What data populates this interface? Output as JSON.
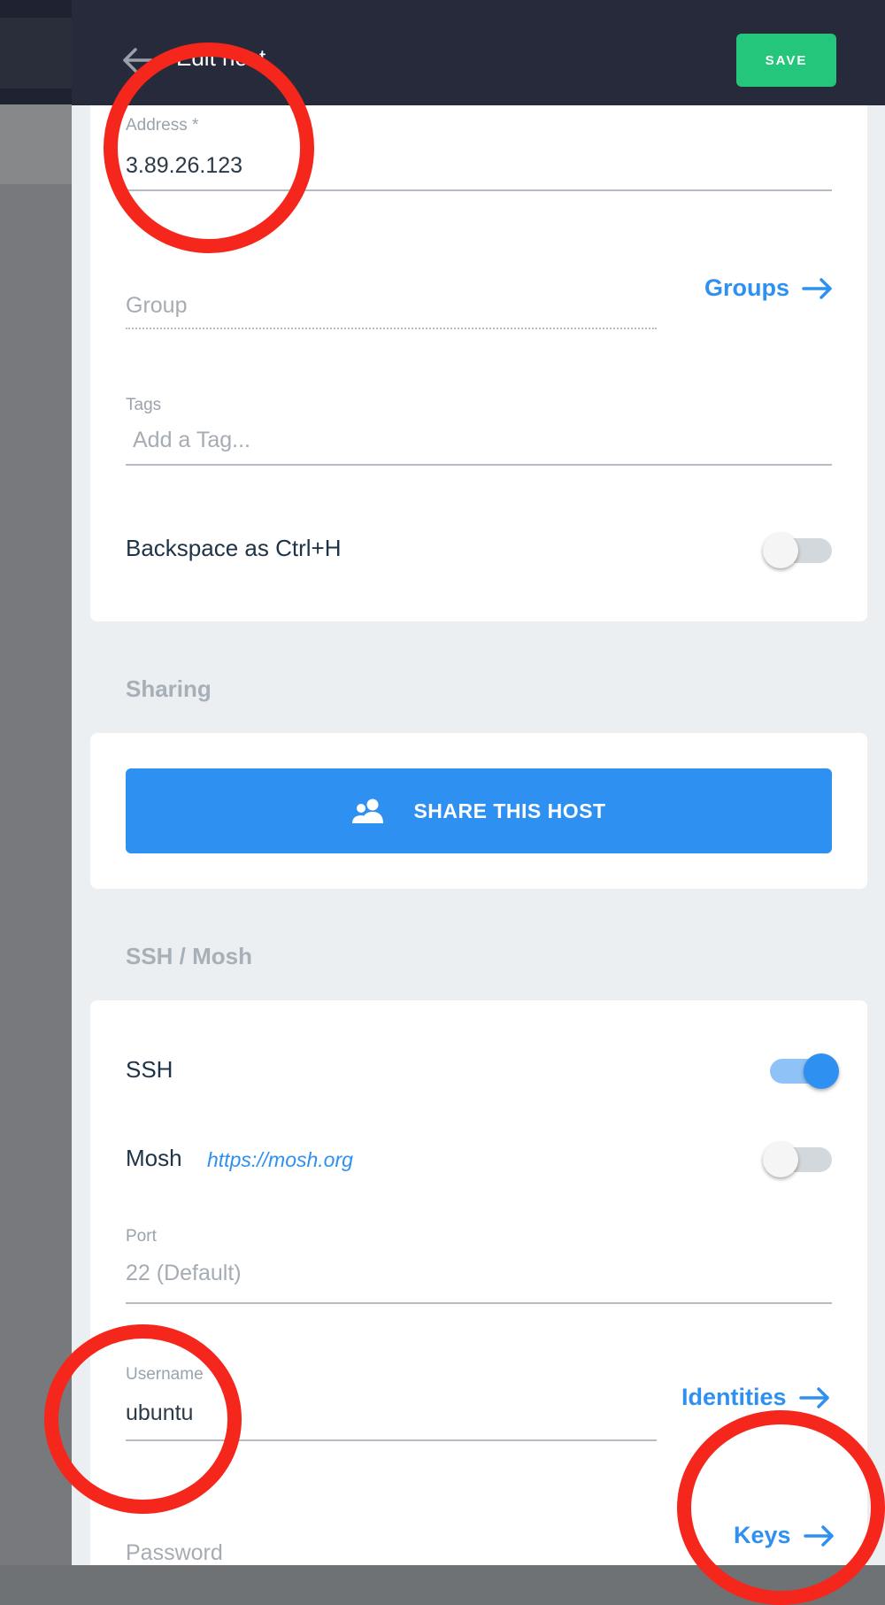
{
  "header": {
    "title": "Edit host",
    "save_label": "SAVE"
  },
  "general": {
    "address_label": "Address *",
    "address_value": "3.89.26.123",
    "group_placeholder": "Group",
    "groups_link": "Groups",
    "tags_label": "Tags",
    "tags_placeholder": "Add a Tag...",
    "backspace_label": "Backspace as Ctrl+H",
    "backspace_enabled": false
  },
  "sharing": {
    "section_title": "Sharing",
    "share_button": "SHARE THIS HOST"
  },
  "ssh_mosh": {
    "section_title": "SSH / Mosh",
    "ssh_label": "SSH",
    "ssh_enabled": true,
    "mosh_label": "Mosh",
    "mosh_link": "https://mosh.org",
    "mosh_enabled": false,
    "port_label": "Port",
    "port_placeholder": "22 (Default)",
    "username_label": "Username",
    "username_value": "ubuntu",
    "identities_link": "Identities",
    "password_placeholder": "Password",
    "keys_link": "Keys"
  },
  "colors": {
    "accent": "#2e90f0",
    "save": "#23c67a",
    "header": "#272a3a",
    "annotation": "#f5261c"
  },
  "icons": {
    "back": "arrow-left-icon",
    "share": "users-icon",
    "link_arrow": "arrow-right-icon"
  }
}
